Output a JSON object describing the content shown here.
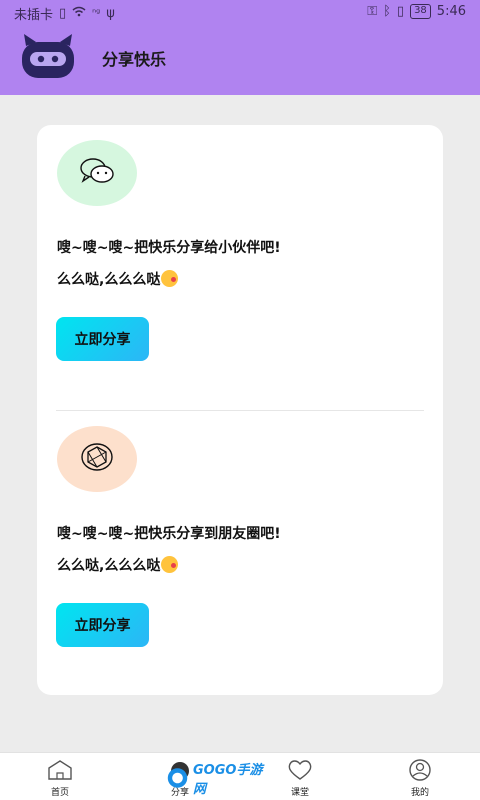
{
  "status_bar": {
    "carrier": "未插卡",
    "battery": "38",
    "time": "5:46"
  },
  "header": {
    "title": "分享快乐"
  },
  "share_items": [
    {
      "icon": "wechat-icon",
      "line1": "嗖~嗖~嗖~把快乐分享给小伙伴吧!",
      "line2": "么么哒,么么么哒",
      "button": "立即分享",
      "circle_color": "#d6f7df"
    },
    {
      "icon": "moments-icon",
      "line1": "嗖~嗖~嗖~把快乐分享到朋友圈吧!",
      "line2": "么么哒,么么么哒",
      "button": "立即分享",
      "circle_color": "#fde0cc"
    }
  ],
  "tabbar": {
    "items": [
      {
        "label": "首页",
        "icon": "home-icon"
      },
      {
        "label": "分享",
        "icon": "share-icon"
      },
      {
        "label": "课堂",
        "icon": "heart-icon"
      },
      {
        "label": "我的",
        "icon": "user-icon"
      }
    ],
    "watermark": "GOGO手游网"
  },
  "colors": {
    "header_bg": "#b083f0",
    "button_gradient_start": "#00e5f0",
    "button_gradient_end": "#2cb6f6"
  }
}
